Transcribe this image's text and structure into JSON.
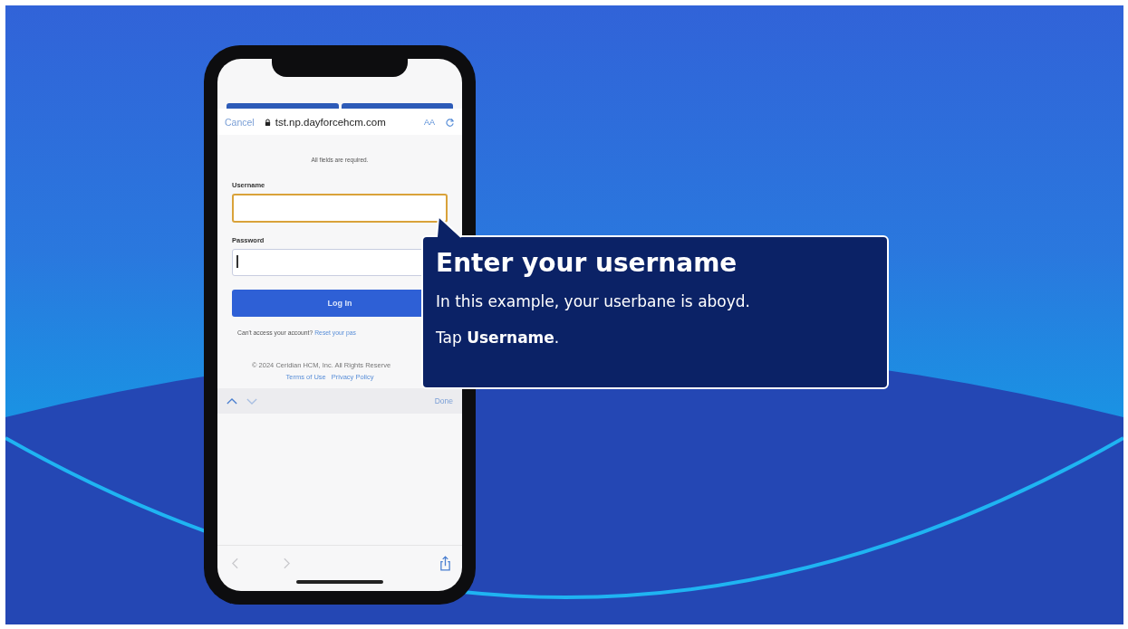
{
  "browser": {
    "cancel": "Cancel",
    "url": "tst.np.dayforcehcm.com",
    "text_size": "AA"
  },
  "form": {
    "instruction": "All fields are required.",
    "fields": [
      {
        "label": "Username",
        "highlighted": true,
        "cursor": false
      },
      {
        "label": "Password",
        "highlighted": false,
        "cursor": true
      }
    ],
    "login_button": "Log In",
    "help_text": "Can't access your account?",
    "help_link": "Reset your pas",
    "copyright": "© 2024 Ceridian HCM, Inc. All Rights Reserve",
    "links": [
      "Terms of Use",
      "Privacy Policy"
    ]
  },
  "keyboard_bar": {
    "done": "Done"
  },
  "callout": {
    "title": "Enter your username",
    "lines": [
      "In this example, your userbane is aboyd.",
      "Tap **Username**."
    ]
  }
}
